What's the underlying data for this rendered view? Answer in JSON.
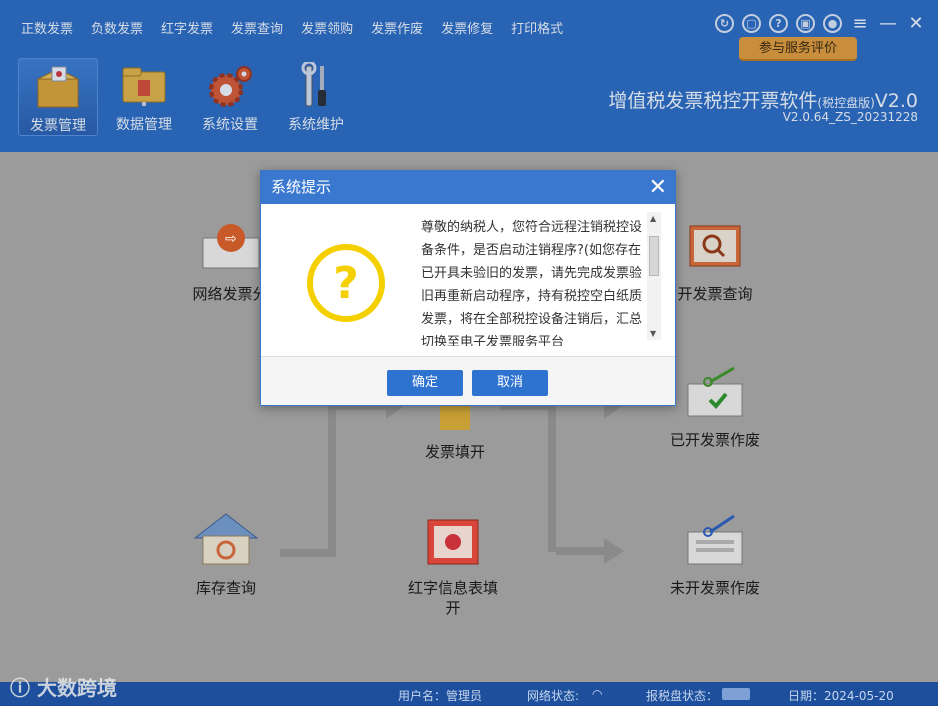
{
  "menu": [
    "正数发票",
    "负数发票",
    "红字发票",
    "发票查询",
    "发票领购",
    "发票作废",
    "发票修复",
    "打印格式"
  ],
  "window_controls": {
    "evaluate_label": "参与服务评价"
  },
  "toolbar": [
    {
      "label": "发票管理",
      "active": true
    },
    {
      "label": "数据管理",
      "active": false
    },
    {
      "label": "系统设置",
      "active": false
    },
    {
      "label": "系统维护",
      "active": false
    }
  ],
  "app": {
    "title": "增值税发票税控开票软件",
    "edition": "(税控盘版)",
    "version_short": "V2.0",
    "version": "V2.0.64_ZS_20231228"
  },
  "functions": {
    "network_invoice": "网络发票分",
    "invoice_query": "开发票查询",
    "invoice_fill": "发票填开",
    "issued_void": "已开发票作废",
    "stock_query": "库存查询",
    "red_info": "红字信息表填开",
    "unissued_void": "未开发票作废"
  },
  "dialog": {
    "title": "系统提示",
    "message": "尊敬的纳税人，您符合远程注销税控设备条件，是否启动注销程序?(如您存在已开具未验旧的发票，请先完成发票验旧再重新启动程序，持有税控空白纸质发票，将在全部税控设备注销后，汇总切换至电子发票服务平台",
    "confirm_label": "确定",
    "cancel_label": "取消"
  },
  "status": {
    "user_label": "用户名：",
    "user_value": "管理员",
    "network_label": "网络状态:",
    "device_label": "报税盘状态：",
    "date_label": "日期：",
    "date_value": "2024-05-20"
  },
  "watermark": "大数跨境",
  "colors": {
    "header": "#2b6cc4",
    "dialog_title": "#3a78d0",
    "button": "#2f73d0",
    "question_icon": "#f5d000",
    "eval_button": "#f0a030"
  }
}
